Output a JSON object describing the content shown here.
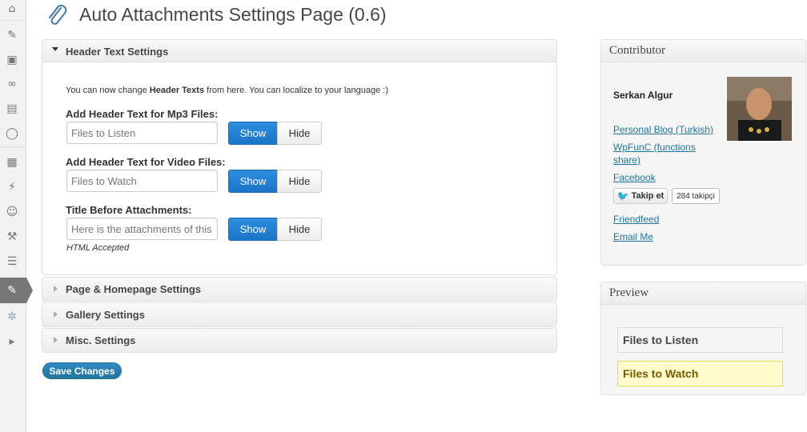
{
  "page": {
    "title": "Auto Attachments Settings Page (0.6)"
  },
  "sidebar": {
    "icons": [
      "home-icon",
      "pin-icon",
      "media-icon",
      "links-icon",
      "pages-icon",
      "comments-icon",
      "appearance-icon",
      "plugins-icon",
      "users-icon",
      "tools-icon",
      "settings-icon",
      "auto-attachments-icon",
      "gear-icon",
      "play-icon"
    ]
  },
  "sections": {
    "header": {
      "title": "Header Text Settings"
    },
    "page": {
      "title": "Page & Homepage Settings"
    },
    "gallery": {
      "title": "Gallery Settings"
    },
    "misc": {
      "title": "Misc. Settings"
    }
  },
  "header_settings": {
    "intro_pre": "You can now change ",
    "intro_bold": "Header Texts",
    "intro_post": " from here. You can localize to your language :)",
    "fields": [
      {
        "label": "Add Header Text for Mp3 Files:",
        "value": "Files to Listen",
        "show": "Show",
        "hide": "Hide"
      },
      {
        "label": "Add Header Text for Video Files:",
        "value": "Files to Watch",
        "show": "Show",
        "hide": "Hide"
      },
      {
        "label": "Title Before Attachments:",
        "value": "Here is the attachments of this",
        "show": "Show",
        "hide": "Hide"
      }
    ],
    "note": "HTML Accepted"
  },
  "save_label": "Save Changes",
  "contributor": {
    "title": "Contributor",
    "name": "Serkan Algur",
    "links": [
      "Personal Blog (Turkish)",
      "WpFunC (functions share)",
      "Facebook",
      "Friendfeed",
      "Email Me"
    ],
    "twitter_label": "Takip et",
    "twitter_count": "284 takipçi"
  },
  "preview": {
    "title": "Preview",
    "mp3": "Files to Listen",
    "video": "Files to Watch"
  },
  "colors": {
    "primary_button": "#1b74c8",
    "link": "#21759b",
    "highlight": "#fffbcc"
  }
}
